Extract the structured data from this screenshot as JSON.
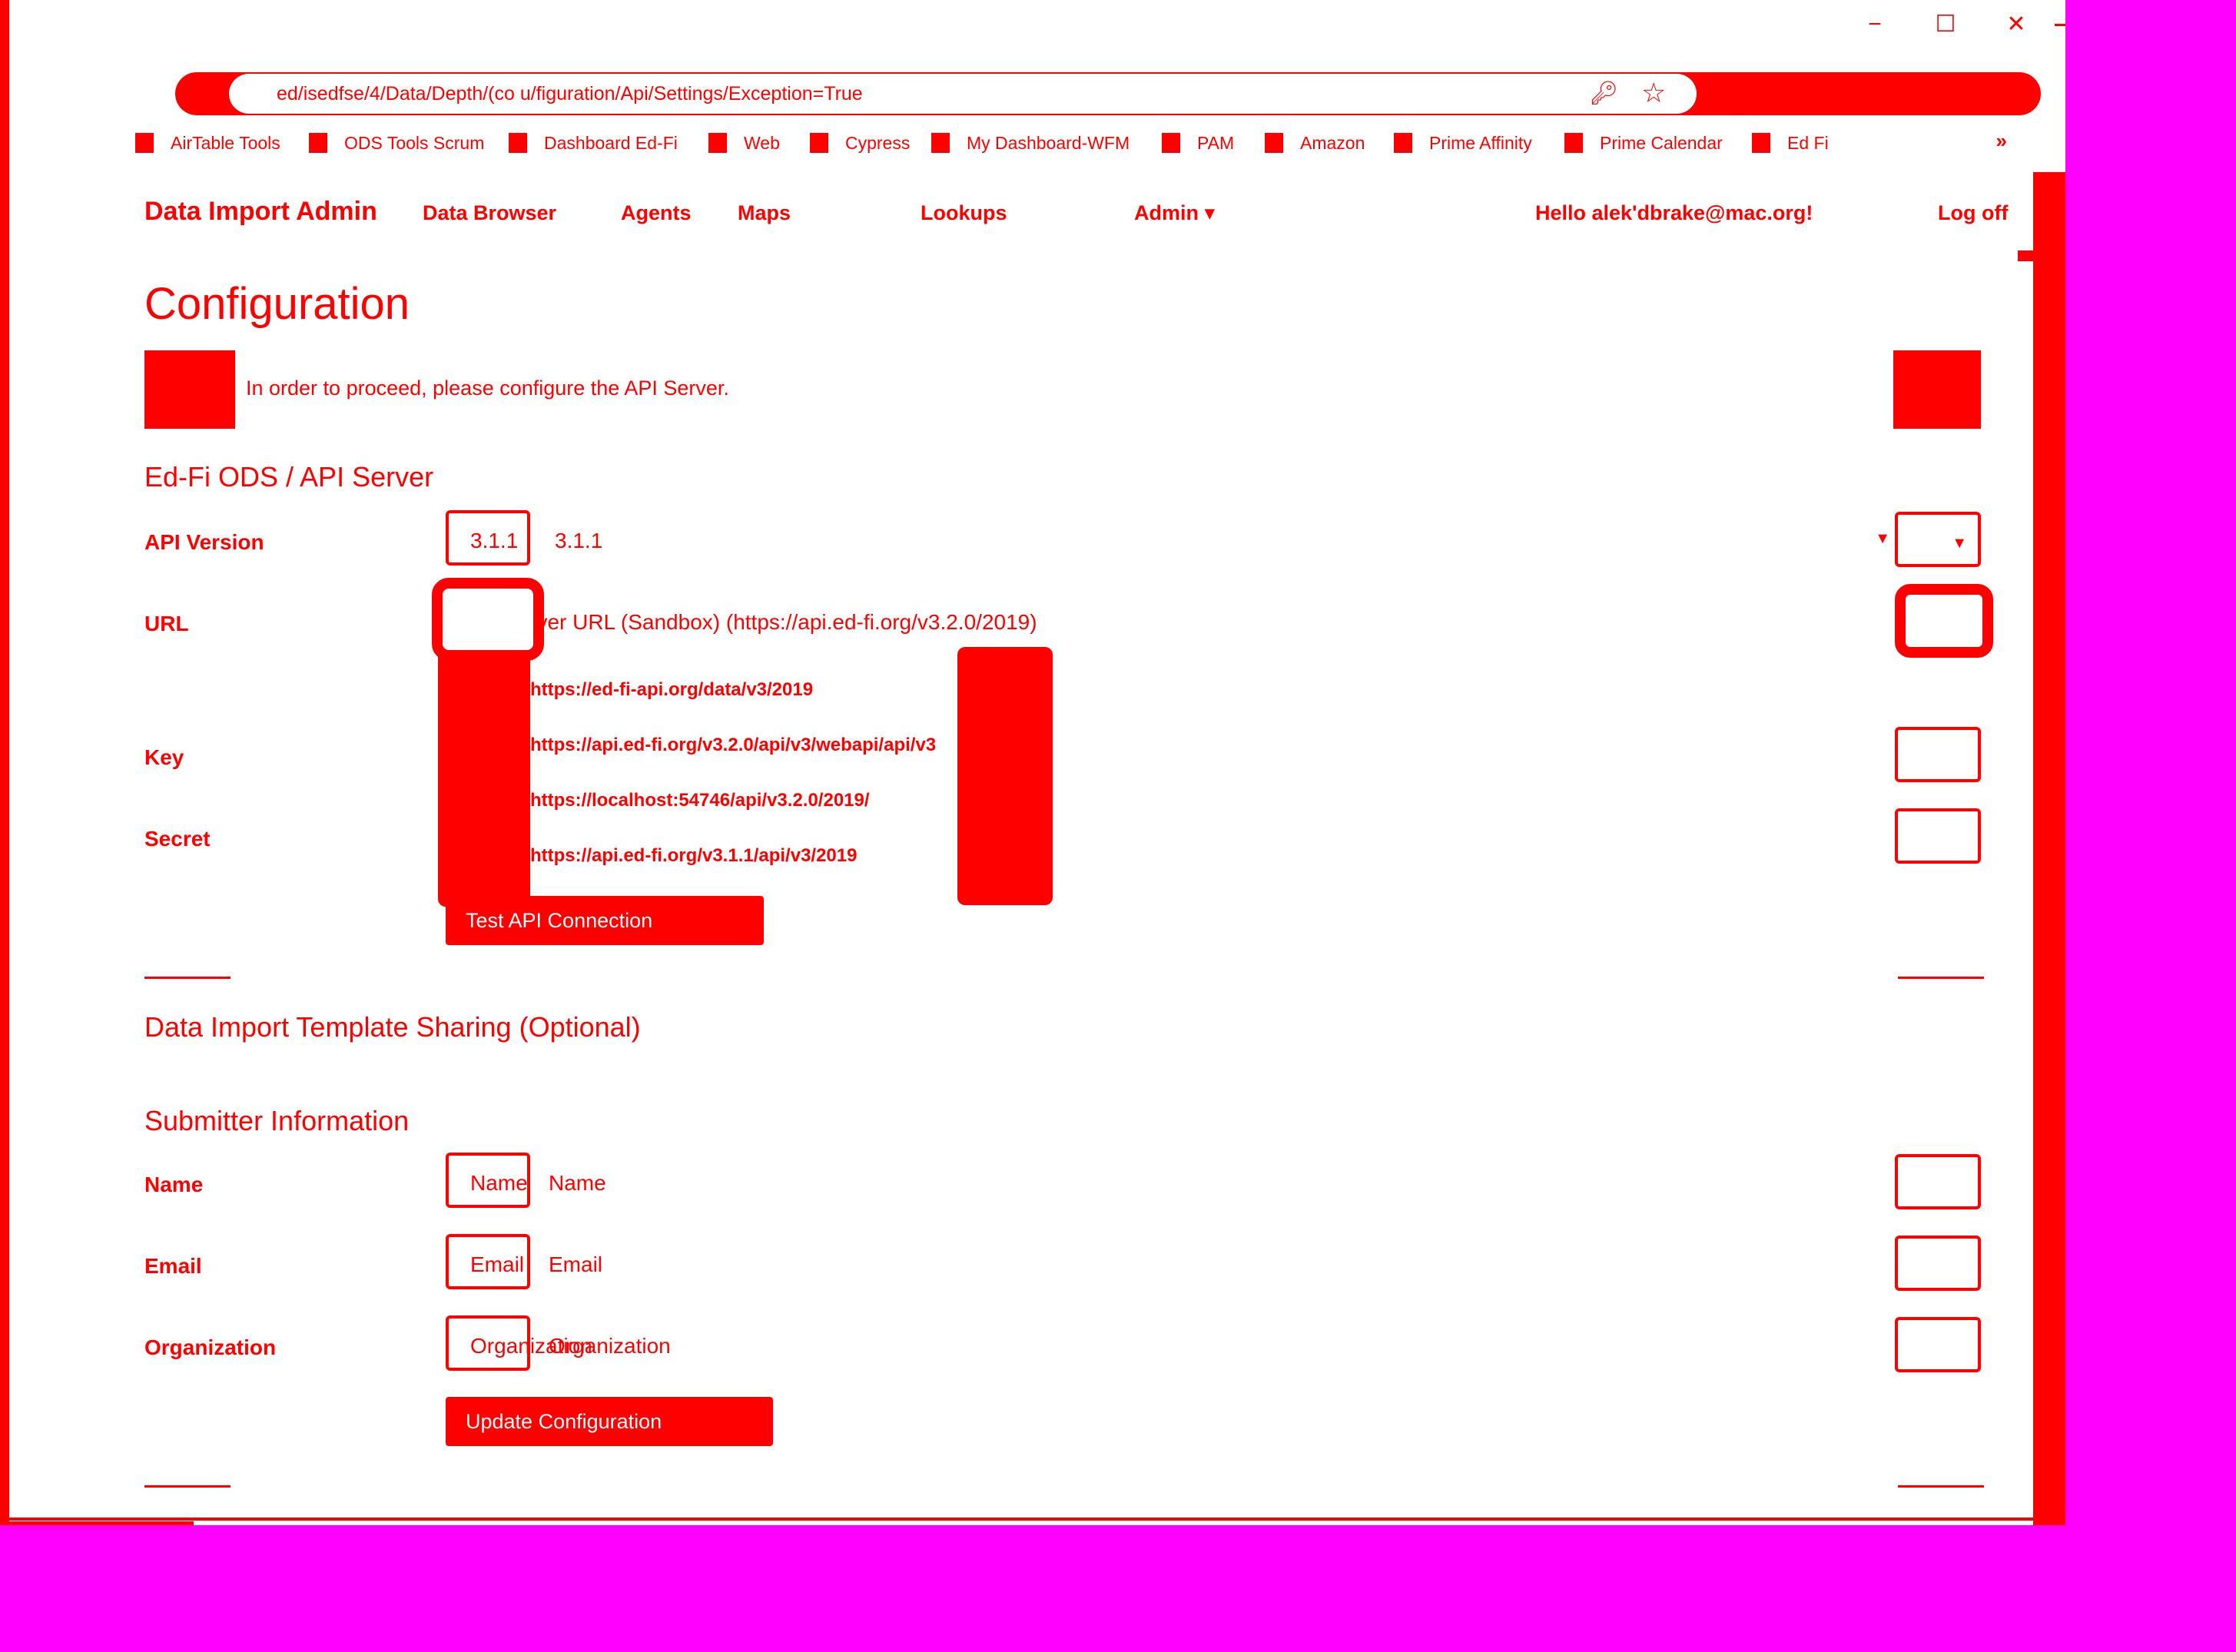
{
  "window": {
    "controls": {
      "minimize": "−",
      "maximize": "☐",
      "close": "✕"
    }
  },
  "browser": {
    "url": "ed/isedfse/4/Data/Depth/(co   u/figuration/Api/Settings/Exception=True",
    "bookmarks": [
      {
        "label": "AirTable Tools"
      },
      {
        "label": "ODS Tools Scrum"
      },
      {
        "label": "Dashboard Ed-Fi"
      },
      {
        "label": "Web"
      },
      {
        "label": "Cypress"
      },
      {
        "label": "My Dashboard-WFM"
      },
      {
        "label": "PAM"
      },
      {
        "label": "Amazon"
      },
      {
        "label": "Prime Affinity"
      },
      {
        "label": "Prime Calendar"
      },
      {
        "label": "Ed Fi"
      }
    ],
    "more": "»"
  },
  "nav": {
    "brand": "Data Import Admin",
    "links": [
      "Data Browser",
      "Agents",
      "Maps",
      "Lookups",
      "Admin ▾"
    ],
    "greeting": "Hello alek'dbrake@mac.org!",
    "logoff": "Log off"
  },
  "page": {
    "title": "Configuration",
    "alert": "In order to proceed, please configure the API Server.",
    "section_api": "Ed-Fi ODS / API Server",
    "api_version": {
      "label": "API Version",
      "value": "3.1.1"
    },
    "url": {
      "label": "URL",
      "value": "API Server URL (Sandbox) (https://api.ed-fi.org/v3.2.0/2019)"
    },
    "dropdown_options": [
      "https://ed-fi-api.org/data/v3/2019",
      "https://api.ed-fi.org/v3.2.0/api/v3/webapi/api/v3",
      "https://localhost:54746/api/v3.2.0/2019/",
      "https://api.ed-fi.org/v3.1.1/api/v3/2019"
    ],
    "key": {
      "label": "Key"
    },
    "secret": {
      "label": "Secret"
    },
    "test_button": "Test API Connection",
    "section_template": "Data Import Template Sharing (Optional)",
    "section_submitter": "Submitter Information",
    "name": {
      "label": "Name",
      "placeholder": "Name"
    },
    "email": {
      "label": "Email",
      "placeholder": "Email"
    },
    "organization": {
      "label": "Organization",
      "placeholder": "Organization"
    },
    "update_button": "Update Configuration"
  },
  "colors": {
    "accent": "#ff0000",
    "background": "#ff00ff",
    "surface": "#ffffff"
  }
}
